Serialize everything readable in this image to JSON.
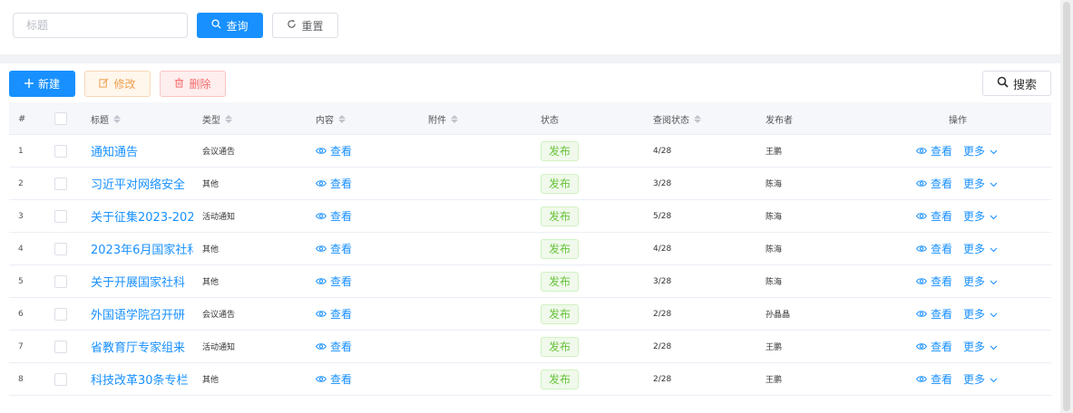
{
  "search": {
    "title_placeholder": "标题",
    "query_label": "查询",
    "reset_label": "重置"
  },
  "toolbar": {
    "new_label": "新建",
    "edit_label": "修改",
    "delete_label": "删除",
    "search_label": "搜索"
  },
  "table": {
    "headers": {
      "index": "#",
      "title": "标题",
      "type": "类型",
      "content": "内容",
      "attachment": "附件",
      "status": "状态",
      "read_status": "查阅状态",
      "publisher": "发布者",
      "actions": "操作"
    },
    "view_label": "查看",
    "more_label": "更多",
    "rows": [
      {
        "index": "1",
        "title": "通知通告",
        "type": "会议通告",
        "status": "发布",
        "read": "4/28",
        "publisher": "王鹏"
      },
      {
        "index": "2",
        "title": "习近平对网络安全",
        "type": "其他",
        "status": "发布",
        "read": "3/28",
        "publisher": "陈海"
      },
      {
        "index": "3",
        "title": "关于征集2023-202",
        "type": "活动通知",
        "status": "发布",
        "read": "5/28",
        "publisher": "陈海"
      },
      {
        "index": "4",
        "title": "2023年6月国家社科",
        "type": "其他",
        "status": "发布",
        "read": "4/28",
        "publisher": "陈海"
      },
      {
        "index": "5",
        "title": "关于开展国家社科",
        "type": "其他",
        "status": "发布",
        "read": "3/28",
        "publisher": "陈海"
      },
      {
        "index": "6",
        "title": "外国语学院召开研",
        "type": "会议通告",
        "status": "发布",
        "read": "2/28",
        "publisher": "孙晶晶"
      },
      {
        "index": "7",
        "title": "省教育厅专家组来",
        "type": "活动通知",
        "status": "发布",
        "read": "2/28",
        "publisher": "王鹏"
      },
      {
        "index": "8",
        "title": "科技改革30条专栏",
        "type": "其他",
        "status": "发布",
        "read": "2/28",
        "publisher": "王鹏"
      }
    ]
  },
  "colors": {
    "primary": "#1890ff",
    "success": "#67c23a",
    "warning": "#f0a050",
    "danger": "#f56c6c"
  }
}
